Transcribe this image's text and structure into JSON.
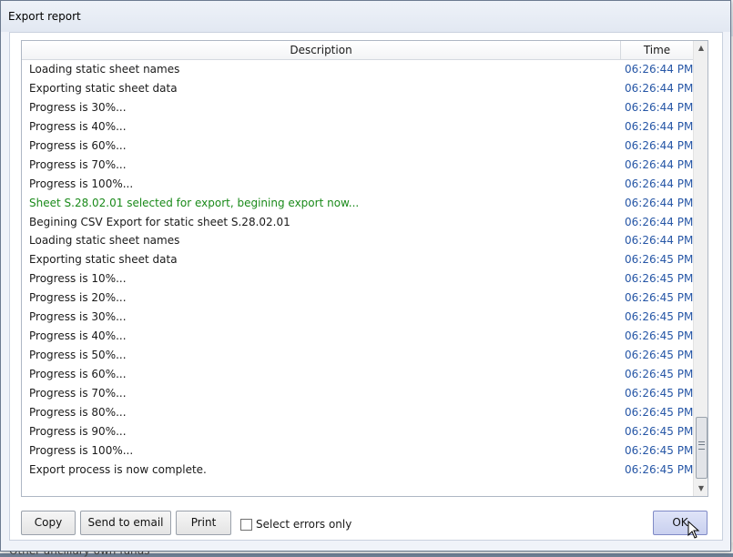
{
  "dialog": {
    "title": "Export report",
    "columns": {
      "description": "Description",
      "time": "Time"
    },
    "rows": [
      {
        "description": "Loading static sheet names",
        "time": "06:26:44 PM"
      },
      {
        "description": "Exporting static sheet data",
        "time": "06:26:44 PM"
      },
      {
        "description": "Progress is 30%...",
        "time": "06:26:44 PM"
      },
      {
        "description": "Progress is 40%...",
        "time": "06:26:44 PM"
      },
      {
        "description": "Progress is 60%...",
        "time": "06:26:44 PM"
      },
      {
        "description": "Progress is 70%...",
        "time": "06:26:44 PM"
      },
      {
        "description": "Progress is 100%...",
        "time": "06:26:44 PM"
      },
      {
        "description": "Sheet S.28.02.01 selected for export, begining export now...",
        "time": "06:26:44 PM"
      },
      {
        "description": "Begining CSV Export for static sheet S.28.02.01",
        "time": "06:26:44 PM"
      },
      {
        "description": "Loading static sheet names",
        "time": "06:26:44 PM"
      },
      {
        "description": "Exporting static sheet data",
        "time": "06:26:45 PM"
      },
      {
        "description": "Progress is 10%...",
        "time": "06:26:45 PM"
      },
      {
        "description": "Progress is 20%...",
        "time": "06:26:45 PM"
      },
      {
        "description": "Progress is 30%...",
        "time": "06:26:45 PM"
      },
      {
        "description": "Progress is 40%...",
        "time": "06:26:45 PM"
      },
      {
        "description": "Progress is 50%...",
        "time": "06:26:45 PM"
      },
      {
        "description": "Progress is 60%...",
        "time": "06:26:45 PM"
      },
      {
        "description": "Progress is 70%...",
        "time": "06:26:45 PM"
      },
      {
        "description": "Progress is 80%...",
        "time": "06:26:45 PM"
      },
      {
        "description": "Progress is 90%...",
        "time": "06:26:45 PM"
      },
      {
        "description": "Progress is 100%...",
        "time": "06:26:45 PM"
      },
      {
        "description": "Export process is now complete.",
        "time": "06:26:45 PM"
      }
    ],
    "highlight_row_index": 7,
    "buttons": {
      "copy": "Copy",
      "email": "Send to email",
      "print": "Print",
      "ok": "OK"
    },
    "select_errors": {
      "label": "Select errors only",
      "checked": false
    }
  },
  "background": {
    "bottom_text": "Other ancillary own funds"
  },
  "colors": {
    "time_text": "#2656a6",
    "highlight_text": "#1a8a1a",
    "ok_button": "#c9d0ef"
  }
}
